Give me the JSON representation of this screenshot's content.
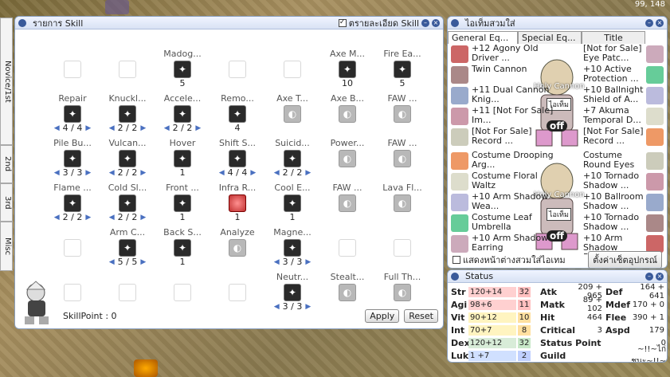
{
  "coords": "99, 148",
  "side_tabs": [
    "Novice/1st",
    "2nd",
    "3rd",
    "Misc"
  ],
  "skill_window": {
    "title": "รายการ Skill",
    "detail_label": "ตรายละเอียด Skill",
    "skill_point_label": "SkillPoint : 0",
    "apply": "Apply",
    "reset": "Reset",
    "cells": [
      {
        "name": "",
        "state": "empty",
        "level": "",
        "arrows": false,
        "col": 0,
        "row": 0
      },
      {
        "name": "",
        "state": "empty",
        "level": "",
        "arrows": false,
        "col": 1,
        "row": 0
      },
      {
        "name": "Madog...",
        "state": "on",
        "level": "5",
        "arrows": false,
        "col": 2,
        "row": 0
      },
      {
        "name": "",
        "state": "empty",
        "level": "",
        "arrows": false,
        "col": 3,
        "row": 0
      },
      {
        "name": "",
        "state": "empty",
        "level": "",
        "arrows": false,
        "col": 4,
        "row": 0
      },
      {
        "name": "Axe M...",
        "state": "on",
        "level": "10",
        "arrows": false,
        "col": 5,
        "row": 0
      },
      {
        "name": "Fire Ea...",
        "state": "on",
        "level": "5",
        "arrows": false,
        "col": 6,
        "row": 0
      },
      {
        "name": "Repair",
        "state": "on",
        "level": "4 / 4",
        "arrows": true,
        "col": 0,
        "row": 1
      },
      {
        "name": "Knuckl...",
        "state": "on",
        "level": "2 / 2",
        "arrows": true,
        "col": 1,
        "row": 1
      },
      {
        "name": "Accele...",
        "state": "on",
        "level": "2 / 2",
        "arrows": true,
        "col": 2,
        "row": 1
      },
      {
        "name": "Remo...",
        "state": "on",
        "level": "4",
        "arrows": false,
        "col": 3,
        "row": 1
      },
      {
        "name": "Axe T...",
        "state": "off",
        "level": "",
        "arrows": false,
        "col": 4,
        "row": 1
      },
      {
        "name": "Axe B...",
        "state": "off",
        "level": "",
        "arrows": false,
        "col": 5,
        "row": 1
      },
      {
        "name": "FAW ...",
        "state": "off",
        "level": "",
        "arrows": false,
        "col": 6,
        "row": 1
      },
      {
        "name": "Pile Bu...",
        "state": "on",
        "level": "3 / 3",
        "arrows": true,
        "col": 0,
        "row": 2
      },
      {
        "name": "Vulcan...",
        "state": "on",
        "level": "2 / 2",
        "arrows": true,
        "col": 1,
        "row": 2
      },
      {
        "name": "Hover",
        "state": "on",
        "level": "1",
        "arrows": false,
        "col": 2,
        "row": 2
      },
      {
        "name": "Shift S...",
        "state": "on",
        "level": "4 / 4",
        "arrows": true,
        "col": 3,
        "row": 2
      },
      {
        "name": "Suicid...",
        "state": "on",
        "level": "2 / 2",
        "arrows": true,
        "col": 4,
        "row": 2
      },
      {
        "name": "Power...",
        "state": "off",
        "level": "",
        "arrows": false,
        "col": 5,
        "row": 2
      },
      {
        "name": "FAW ...",
        "state": "off",
        "level": "",
        "arrows": false,
        "col": 6,
        "row": 2
      },
      {
        "name": "Flame ...",
        "state": "on",
        "level": "2 / 2",
        "arrows": true,
        "col": 0,
        "row": 3
      },
      {
        "name": "Cold Sl...",
        "state": "on",
        "level": "2 / 2",
        "arrows": true,
        "col": 1,
        "row": 3
      },
      {
        "name": "Front ...",
        "state": "on",
        "level": "1",
        "arrows": false,
        "col": 2,
        "row": 3
      },
      {
        "name": "Infra R...",
        "state": "hl",
        "level": "1",
        "arrows": false,
        "col": 3,
        "row": 3
      },
      {
        "name": "Cool E...",
        "state": "on",
        "level": "1",
        "arrows": false,
        "col": 4,
        "row": 3
      },
      {
        "name": "FAW ...",
        "state": "off",
        "level": "",
        "arrows": false,
        "col": 5,
        "row": 3
      },
      {
        "name": "Lava Fl...",
        "state": "off",
        "level": "",
        "arrows": false,
        "col": 6,
        "row": 3
      },
      {
        "name": "",
        "state": "empty",
        "level": "",
        "arrows": false,
        "col": 0,
        "row": 4
      },
      {
        "name": "Arm C...",
        "state": "on",
        "level": "5 / 5",
        "arrows": true,
        "col": 1,
        "row": 4
      },
      {
        "name": "Back S...",
        "state": "on",
        "level": "1",
        "arrows": false,
        "col": 2,
        "row": 4
      },
      {
        "name": "Analyze",
        "state": "off",
        "level": "",
        "arrows": false,
        "col": 3,
        "row": 4
      },
      {
        "name": "Magne...",
        "state": "on",
        "level": "3 / 3",
        "arrows": true,
        "col": 4,
        "row": 4
      },
      {
        "name": "",
        "state": "empty",
        "level": "",
        "arrows": false,
        "col": 5,
        "row": 4
      },
      {
        "name": "",
        "state": "empty",
        "level": "",
        "arrows": false,
        "col": 6,
        "row": 4
      },
      {
        "name": "",
        "state": "empty",
        "level": "",
        "arrows": false,
        "col": 0,
        "row": 5
      },
      {
        "name": "",
        "state": "empty",
        "level": "",
        "arrows": false,
        "col": 1,
        "row": 5
      },
      {
        "name": "",
        "state": "empty",
        "level": "",
        "arrows": false,
        "col": 2,
        "row": 5
      },
      {
        "name": "",
        "state": "empty",
        "level": "",
        "arrows": false,
        "col": 3,
        "row": 5
      },
      {
        "name": "Neutr...",
        "state": "on",
        "level": "3 / 3",
        "arrows": true,
        "col": 4,
        "row": 5
      },
      {
        "name": "Stealt...",
        "state": "off",
        "level": "",
        "arrows": false,
        "col": 5,
        "row": 5
      },
      {
        "name": "Full Th...",
        "state": "off",
        "level": "",
        "arrows": false,
        "col": 6,
        "row": 5
      }
    ]
  },
  "equip_window": {
    "title": "ไอเท็มสวมใส่",
    "tabs": [
      "General Eq...",
      "Special Eq...",
      "Title"
    ],
    "left_items": [
      "+12 Agony Old Driver ...",
      "Twin Cannon",
      "+11 Dual Cannon Knig...",
      "+11 [Not For Sale] Im...",
      "[Not For Sale] Record ...",
      "Costume Drooping Arg...",
      "Costume Floral Waltz",
      "+10 Arm Shadow Wea...",
      "Costume Leaf Umbrella",
      "+10 Arm Shadow Earring"
    ],
    "right_items": [
      "[Not for Sale] Eye Patc...",
      "+10 Active Protection ...",
      "+10 Ballnight Shield of A...",
      "+7 Akuma Temporal D...",
      "[Not For Sale] Record ...",
      "Costume Round Eyes",
      "+10 Tornado Shadow ...",
      "+10 Ballroom Shadow ...",
      "+10 Tornado Shadow ...",
      "+10 Arm Shadow Pen..."
    ],
    "char_label_top": "Holy Cannon",
    "char_badge": "ไอเท็ม",
    "off_label": "off",
    "show_label": "แสดงหน้าต่างสวมใส่ไอเทม",
    "setting_button": "ตั้งค่าเซ็ตอุปกรณ์"
  },
  "status_window": {
    "title": "Status",
    "stats": [
      {
        "label": "Str",
        "value": "120+14",
        "bonus": "32"
      },
      {
        "label": "Agi",
        "value": "98+6",
        "bonus": "11"
      },
      {
        "label": "Vit",
        "value": "90+12",
        "bonus": "10"
      },
      {
        "label": "Int",
        "value": "70+7",
        "bonus": "8"
      },
      {
        "label": "Dex",
        "value": "120+12",
        "bonus": "32"
      },
      {
        "label": "Luk",
        "value": "1 +7",
        "bonus": "2"
      }
    ],
    "right": [
      {
        "l1": "Atk",
        "v1": "209 + 965",
        "l2": "Def",
        "v2": "164 + 641"
      },
      {
        "l1": "Matk",
        "v1": "89 + 102",
        "l2": "Mdef",
        "v2": "170 + 0"
      },
      {
        "l1": "Hit",
        "v1": "464",
        "l2": "Flee",
        "v2": "390 + 1"
      },
      {
        "l1": "Critical",
        "v1": "3",
        "l2": "Aspd",
        "v2": "179"
      },
      {
        "l1": "Status Point",
        "v1": "0",
        "l2": "",
        "v2": ""
      },
      {
        "l1": "Guild",
        "v1": "~!!~ไก่ชนะ~!!~",
        "l2": "",
        "v2": ""
      }
    ]
  }
}
